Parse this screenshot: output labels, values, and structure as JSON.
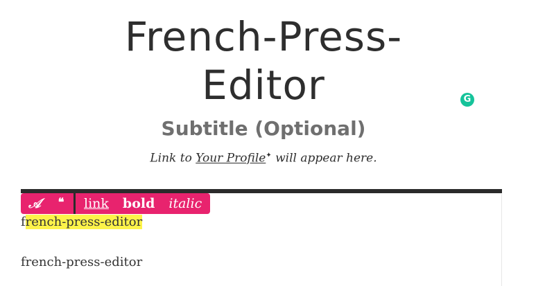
{
  "header": {
    "title": "French-Press-Editor",
    "subtitle": "Subtitle (Optional)",
    "profile_prefix": "Link to ",
    "profile_link": "Your Profile",
    "profile_marker": "✦",
    "profile_suffix": " will appear here."
  },
  "grammarly": {
    "icon": "grammarly-icon",
    "glyph": "G"
  },
  "toolbar": {
    "style_glyph": "𝒜",
    "quote_glyph": "❝",
    "link_label": "link",
    "bold_label": "bold",
    "italic_label": "italic",
    "color": "#e8236e"
  },
  "editor": {
    "para1_plain": "f",
    "para1_highlighted": "rench-press-editor",
    "para2": "french-press-editor",
    "highlight_color": "#fdf34a"
  }
}
